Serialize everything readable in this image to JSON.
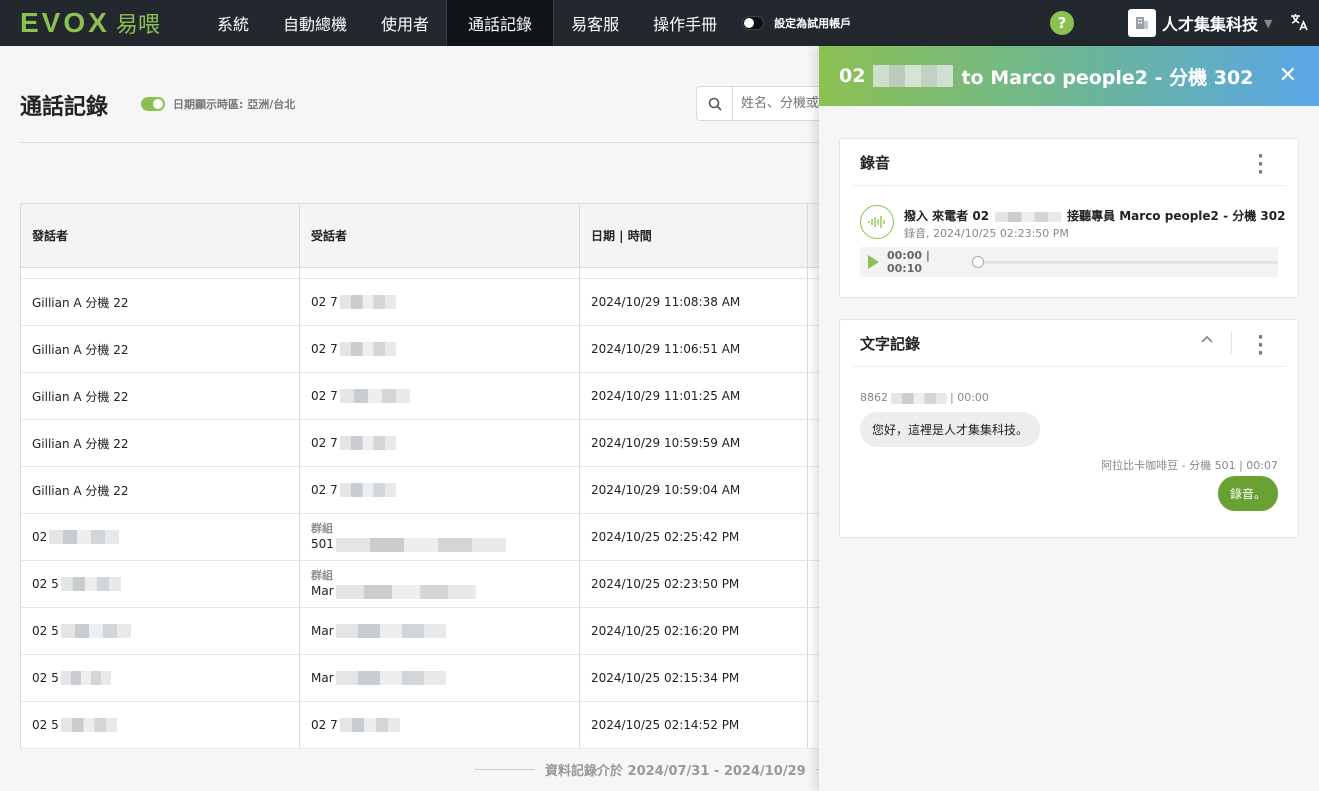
{
  "brand": {
    "logo_text": "EVOX",
    "logo_cn": "易喂"
  },
  "nav": {
    "items": [
      {
        "label": "系統"
      },
      {
        "label": "自動總機"
      },
      {
        "label": "使用者"
      },
      {
        "label": "通話記錄"
      },
      {
        "label": "易客服"
      },
      {
        "label": "操作手冊"
      }
    ],
    "trial_label": "設定為試用帳戶",
    "help_label": "?",
    "company_name": "人才集集科技",
    "lang_icon": "translate-icon"
  },
  "page": {
    "title": "通話記錄",
    "timezone_label": "日期顯示時區: 亞洲/台北",
    "search_placeholder": "姓名、分機或"
  },
  "table": {
    "headers": [
      "發話者",
      "受話者",
      "日期 | 時間"
    ],
    "rows": [
      {
        "caller": "Gillian A 分機 22",
        "callee": "02 7",
        "callee_sub": "",
        "datetime": "2024/10/29 11:08:38 AM"
      },
      {
        "caller": "Gillian A 分機 22",
        "callee": "02 7",
        "callee_sub": "",
        "datetime": "2024/10/29 11:06:51 AM"
      },
      {
        "caller": "Gillian A 分機 22",
        "callee": "02 7",
        "callee_sub": "",
        "datetime": "2024/10/29 11:01:25 AM"
      },
      {
        "caller": "Gillian A 分機 22",
        "callee": "02 7",
        "callee_sub": "",
        "datetime": "2024/10/29 10:59:59 AM"
      },
      {
        "caller": "Gillian A 分機 22",
        "callee": "02 7",
        "callee_sub": "",
        "datetime": "2024/10/29 10:59:04 AM"
      },
      {
        "caller": "02",
        "callee": "501",
        "callee_sub": "群組",
        "datetime": "2024/10/25 02:25:42 PM"
      },
      {
        "caller": "02 5",
        "callee": "Mar",
        "callee_sub": "群組",
        "datetime": "2024/10/25 02:23:50 PM"
      },
      {
        "caller": "02 5",
        "callee": "Mar",
        "callee_sub": "",
        "datetime": "2024/10/25 02:16:20 PM"
      },
      {
        "caller": "02 5",
        "callee": "Mar",
        "callee_sub": "",
        "datetime": "2024/10/25 02:15:34 PM"
      },
      {
        "caller": "02 5",
        "callee": "02 7",
        "callee_sub": "",
        "datetime": "2024/10/25 02:14:52 PM"
      }
    ],
    "footer_note": "資料記錄介於 2024/07/31 - 2024/10/29"
  },
  "panel": {
    "title_prefix": "02",
    "title_suffix": "to Marco people2 - 分機 302",
    "recording": {
      "title": "錄音",
      "item_prefix": "撥入 來電者 02",
      "item_suffix": "接聽專員 Marco people2 - 分機 302",
      "item_sub": "錄音, 2024/10/25 02:23:50 PM",
      "player_time": "00:00 | 00:10"
    },
    "transcript": {
      "title": "文字記錄",
      "incoming_meta_prefix": "8862",
      "incoming_meta_suffix": "| 00:00",
      "incoming_text": "您好，這裡是人才集集科技。",
      "outgoing_meta": "阿拉比卡咖啡豆 - 分機 501 | 00:07",
      "outgoing_text": "錄音。"
    }
  },
  "colors": {
    "accent": "#8cc152",
    "topbar": "#22282d",
    "bubble_out": "#6aa133"
  }
}
